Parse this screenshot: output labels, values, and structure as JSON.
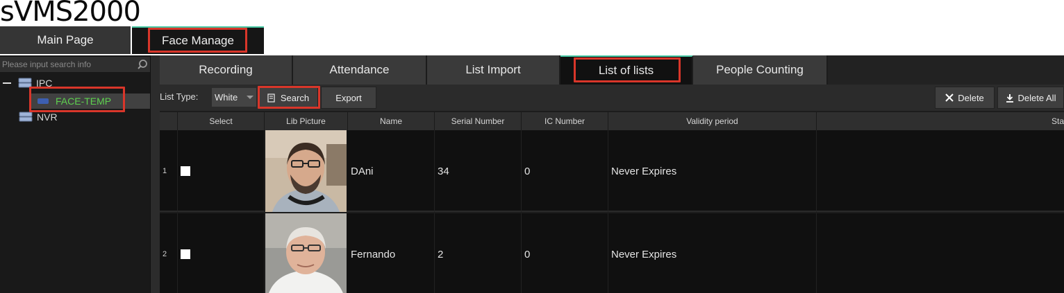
{
  "app": {
    "title": "sVMS2000"
  },
  "top_tabs": [
    {
      "label": "Main Page"
    },
    {
      "label": "Face Manage"
    }
  ],
  "sidebar": {
    "search_placeholder": "Please input search info",
    "tree": [
      {
        "label": "IPC",
        "icon": "disk-icon"
      },
      {
        "label": "FACE-TEMP",
        "icon": "camera-icon"
      },
      {
        "label": "NVR",
        "icon": "disk-icon"
      }
    ]
  },
  "sub_tabs": [
    {
      "label": "Recording"
    },
    {
      "label": "Attendance"
    },
    {
      "label": "List Import"
    },
    {
      "label": "List of lists"
    },
    {
      "label": "People Counting"
    }
  ],
  "toolbar": {
    "list_type_label": "List Type:",
    "list_type_value": "White",
    "search_label": "Search",
    "export_label": "Export",
    "delete_label": "Delete",
    "delete_all_label": "Delete All"
  },
  "table": {
    "columns": [
      "Select",
      "Lib Picture",
      "Name",
      "Serial Number",
      "IC Number",
      "Validity period",
      "Sta"
    ],
    "rows": [
      {
        "index": "1",
        "name": "DAni",
        "serial": "34",
        "ic": "0",
        "validity": "Never Expires"
      },
      {
        "index": "2",
        "name": "Fernando",
        "serial": "2",
        "ic": "0",
        "validity": "Never Expires"
      }
    ]
  },
  "colors": {
    "accent": "#46c7a3",
    "highlight": "#d9362a",
    "tree_selected_text": "#5ed14f"
  }
}
